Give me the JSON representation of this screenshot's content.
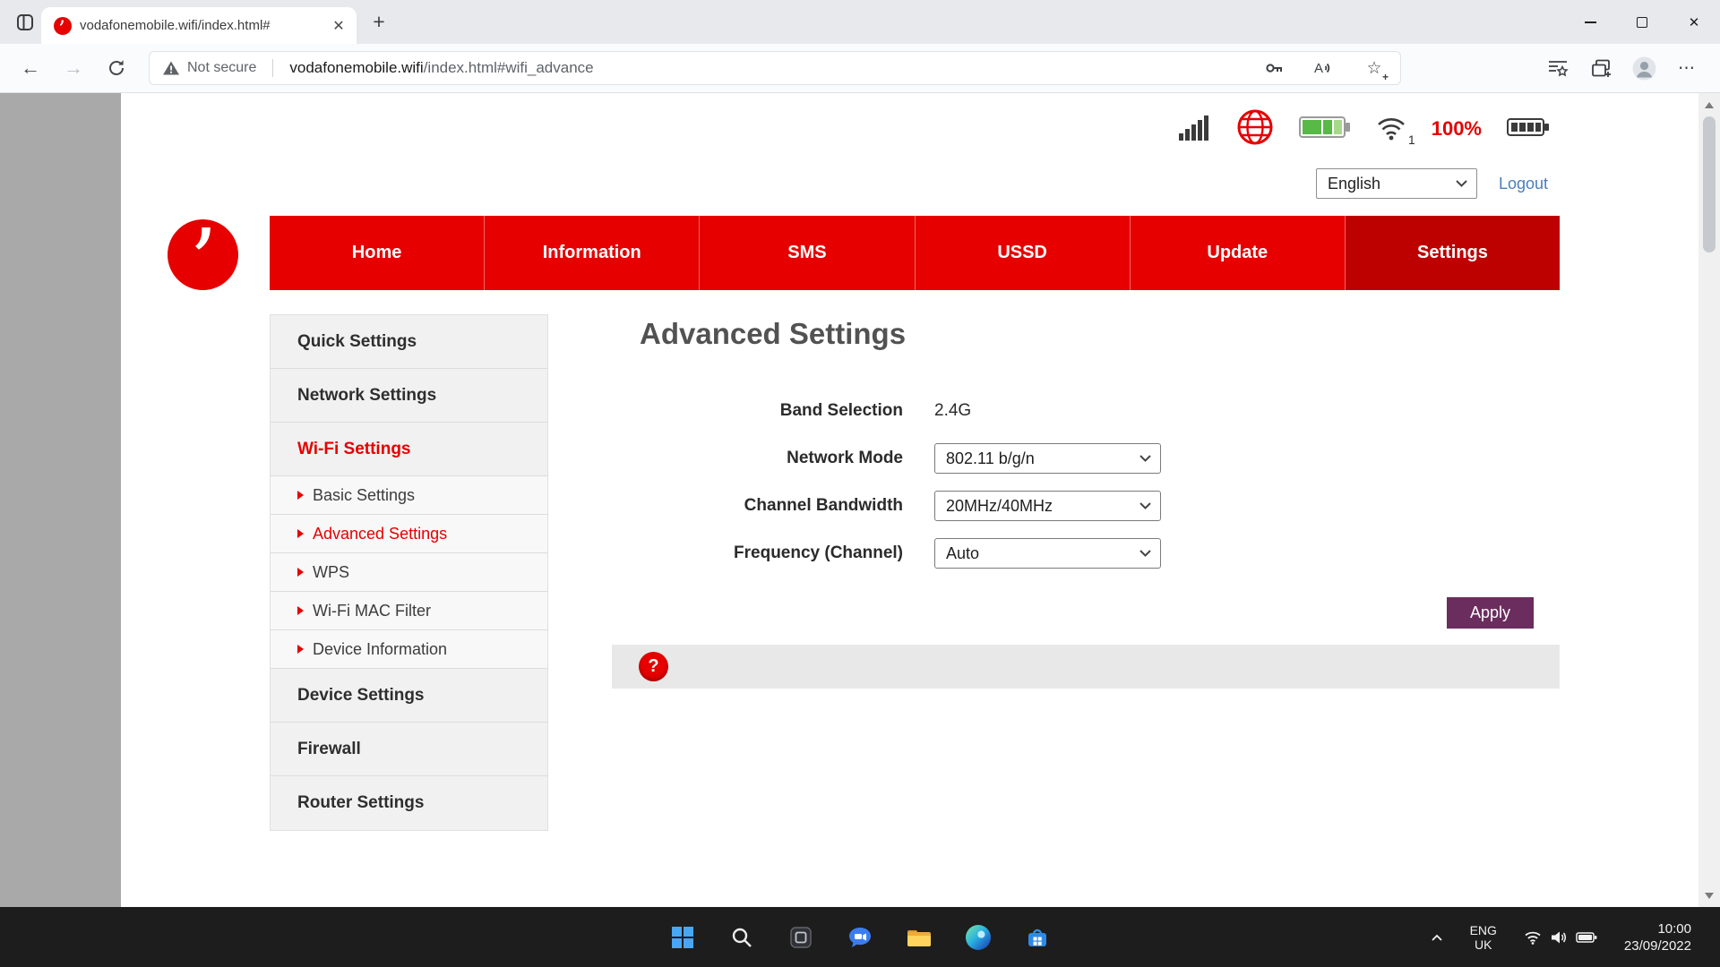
{
  "browser": {
    "tab_title": "vodafonemobile.wifi/index.html#",
    "tab_close_glyph": "✕",
    "new_tab_glyph": "+",
    "back_glyph": "←",
    "forward_glyph": "→",
    "security_label": "Not secure",
    "url_domain": "vodafonemobile.wifi",
    "url_path": "/index.html#wifi_advance",
    "more_glyph": "⋯",
    "window_close_glyph": "✕"
  },
  "icons": {
    "star_glyph": "☆",
    "plus_glyph": "+",
    "logo_glyph": "’"
  },
  "site": {
    "status": {
      "battery_percent": "100%",
      "wifi_connected_count": "1"
    },
    "language_selected": "English",
    "logout_label": "Logout",
    "nav": {
      "active": "Settings",
      "items": [
        {
          "label": "Home"
        },
        {
          "label": "Information"
        },
        {
          "label": "SMS"
        },
        {
          "label": "USSD"
        },
        {
          "label": "Update"
        },
        {
          "label": "Settings"
        }
      ]
    },
    "sidebar": {
      "items": [
        {
          "label": "Quick Settings",
          "type": "section"
        },
        {
          "label": "Network Settings",
          "type": "section"
        },
        {
          "label": "Wi-Fi Settings",
          "type": "section",
          "active": true
        },
        {
          "label": "Basic Settings",
          "type": "sub"
        },
        {
          "label": "Advanced Settings",
          "type": "sub",
          "active": true
        },
        {
          "label": "WPS",
          "type": "sub"
        },
        {
          "label": "Wi-Fi MAC Filter",
          "type": "sub"
        },
        {
          "label": "Device Information",
          "type": "sub"
        },
        {
          "label": "Device Settings",
          "type": "section"
        },
        {
          "label": "Firewall",
          "type": "section"
        },
        {
          "label": "Router Settings",
          "type": "section"
        }
      ]
    },
    "main": {
      "title": "Advanced Settings",
      "band": {
        "label": "Band Selection",
        "value": "2.4G"
      },
      "network_mode": {
        "label": "Network Mode",
        "value": "802.11 b/g/n"
      },
      "channel_bandwidth": {
        "label": "Channel Bandwidth",
        "value": "20MHz/40MHz"
      },
      "frequency": {
        "label": "Frequency (Channel)",
        "value": "Auto"
      },
      "apply_label": "Apply",
      "help_symbol": "?"
    }
  },
  "taskbar": {
    "language_line1": "ENG",
    "language_line2": "UK",
    "time": "10:00",
    "date": "23/09/2022"
  },
  "colors": {
    "brand_red": "#e60000",
    "nav_active_red": "#bd0000",
    "apply_button": "#6b2d5e",
    "link_blue": "#4a7dbe",
    "battery_green": "#58b947"
  }
}
